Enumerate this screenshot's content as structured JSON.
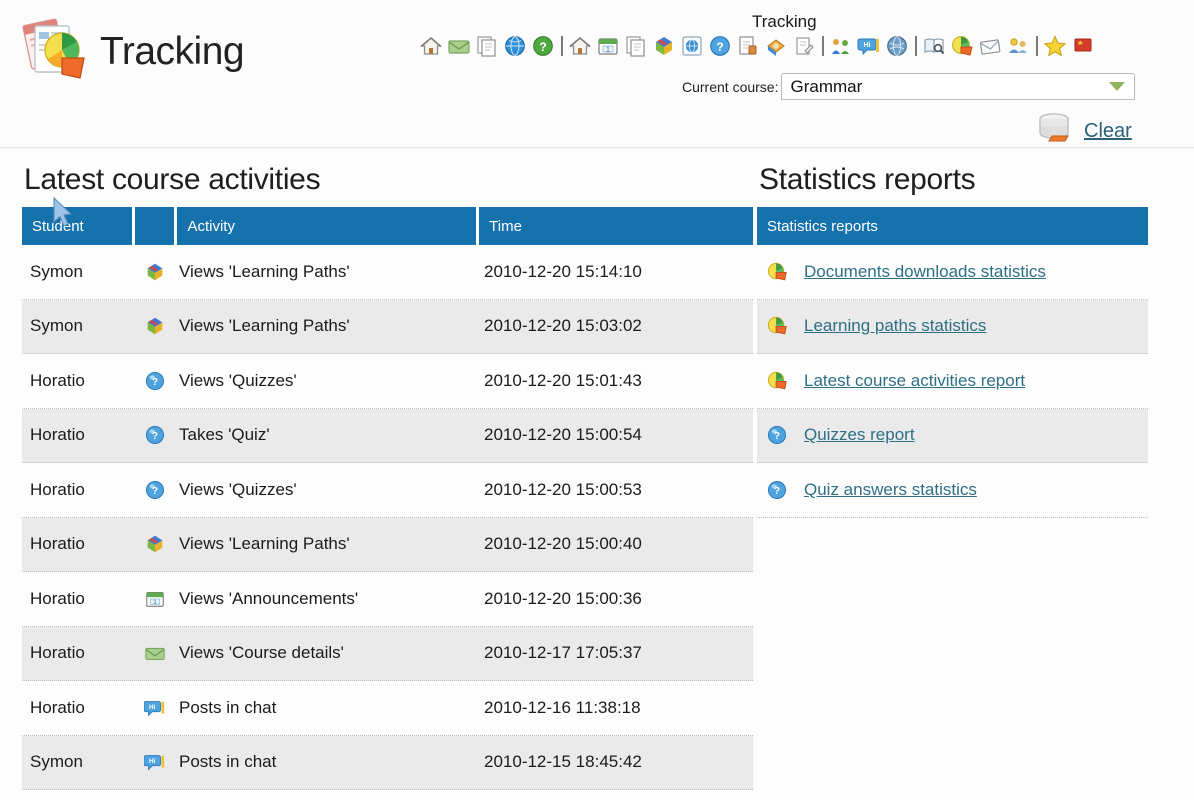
{
  "header": {
    "app_title": "Tracking",
    "logo_icon": "tracking-pie-document-icon",
    "toolbar_tooltip": "Tracking",
    "toolbar_icons": [
      {
        "name": "home-icon",
        "glyph": "home"
      },
      {
        "name": "inbox-envelope-icon",
        "glyph": "envelope"
      },
      {
        "name": "documents-icon",
        "glyph": "documents"
      },
      {
        "name": "globe-blue-icon",
        "glyph": "globe-blue"
      },
      {
        "name": "help-green-globe-icon",
        "glyph": "globe-green-q"
      },
      {
        "name": "separator",
        "glyph": "sep"
      },
      {
        "name": "course-home-icon",
        "glyph": "home"
      },
      {
        "name": "announcements-calendar-icon",
        "glyph": "calendar"
      },
      {
        "name": "course-documents-icon",
        "glyph": "documents"
      },
      {
        "name": "learning-paths-icon",
        "glyph": "puzzle"
      },
      {
        "name": "links-globe-icon",
        "glyph": "globe-square"
      },
      {
        "name": "quizzes-globe-icon",
        "glyph": "globe-blue-q"
      },
      {
        "name": "assignments-icon",
        "glyph": "assignment"
      },
      {
        "name": "dropbox-icon",
        "glyph": "dropbox"
      },
      {
        "name": "notes-icon",
        "glyph": "notes"
      },
      {
        "name": "separator",
        "glyph": "sep"
      },
      {
        "name": "users-group-icon",
        "glyph": "users"
      },
      {
        "name": "chat-icon",
        "glyph": "chat"
      },
      {
        "name": "forums-globe-icon",
        "glyph": "globe-dark"
      },
      {
        "name": "separator",
        "glyph": "sep"
      },
      {
        "name": "search-book-icon",
        "glyph": "book-search"
      },
      {
        "name": "tracking-pie-icon",
        "glyph": "pie"
      },
      {
        "name": "mail-icon",
        "glyph": "mail"
      },
      {
        "name": "groups-icon",
        "glyph": "groups"
      },
      {
        "name": "separator",
        "glyph": "sep"
      },
      {
        "name": "favourites-star-icon",
        "glyph": "star"
      },
      {
        "name": "flag-red-icon",
        "glyph": "flag"
      }
    ],
    "course_label": "Current course:",
    "course_value": "Grammar",
    "course_dropdown_icon": "chevron-down-icon",
    "clear_label": "Clear",
    "clear_icon": "database-clear-icon"
  },
  "activities": {
    "heading": "Latest course activities",
    "columns": [
      "Student",
      "",
      "Activity",
      "Time"
    ],
    "rows": [
      {
        "student": "Symon",
        "icon": "learning-paths-icon",
        "activity": "Views 'Learning Paths'",
        "time": "2010-12-20 15:14:10"
      },
      {
        "student": "Symon",
        "icon": "learning-paths-icon",
        "activity": "Views 'Learning Paths'",
        "time": "2010-12-20 15:03:02"
      },
      {
        "student": "Horatio",
        "icon": "quizzes-icon",
        "activity": "Views 'Quizzes'",
        "time": "2010-12-20 15:01:43"
      },
      {
        "student": "Horatio",
        "icon": "quizzes-icon",
        "activity": "Takes 'Quiz'",
        "time": "2010-12-20 15:00:54"
      },
      {
        "student": "Horatio",
        "icon": "quizzes-icon",
        "activity": "Views 'Quizzes'",
        "time": "2010-12-20 15:00:53"
      },
      {
        "student": "Horatio",
        "icon": "learning-paths-icon",
        "activity": "Views 'Learning Paths'",
        "time": "2010-12-20 15:00:40"
      },
      {
        "student": "Horatio",
        "icon": "announcements-icon",
        "activity": "Views 'Announcements'",
        "time": "2010-12-20 15:00:36"
      },
      {
        "student": "Horatio",
        "icon": "course-details-icon",
        "activity": "Views 'Course details'",
        "time": "2010-12-17 17:05:37"
      },
      {
        "student": "Horatio",
        "icon": "chat-icon",
        "activity": "Posts in chat",
        "time": "2010-12-16 11:38:18"
      },
      {
        "student": "Symon",
        "icon": "chat-icon",
        "activity": "Posts in chat",
        "time": "2010-12-15 18:45:42"
      }
    ]
  },
  "reports": {
    "heading": "Statistics reports",
    "column": "Statistics reports",
    "rows": [
      {
        "icon": "pie-chart-icon",
        "label": "Documents downloads statistics"
      },
      {
        "icon": "pie-chart-icon",
        "label": "Learning paths statistics"
      },
      {
        "icon": "pie-chart-icon",
        "label": "Latest course activities report"
      },
      {
        "icon": "quizzes-icon",
        "label": "Quizzes report"
      },
      {
        "icon": "quizzes-icon",
        "label": "Quiz answers statistics"
      }
    ]
  },
  "colors": {
    "header_blue": "#1572ad",
    "link_teal": "#2e6f86",
    "row_alt": "#eaeaea",
    "text": "#1b1b1b"
  }
}
